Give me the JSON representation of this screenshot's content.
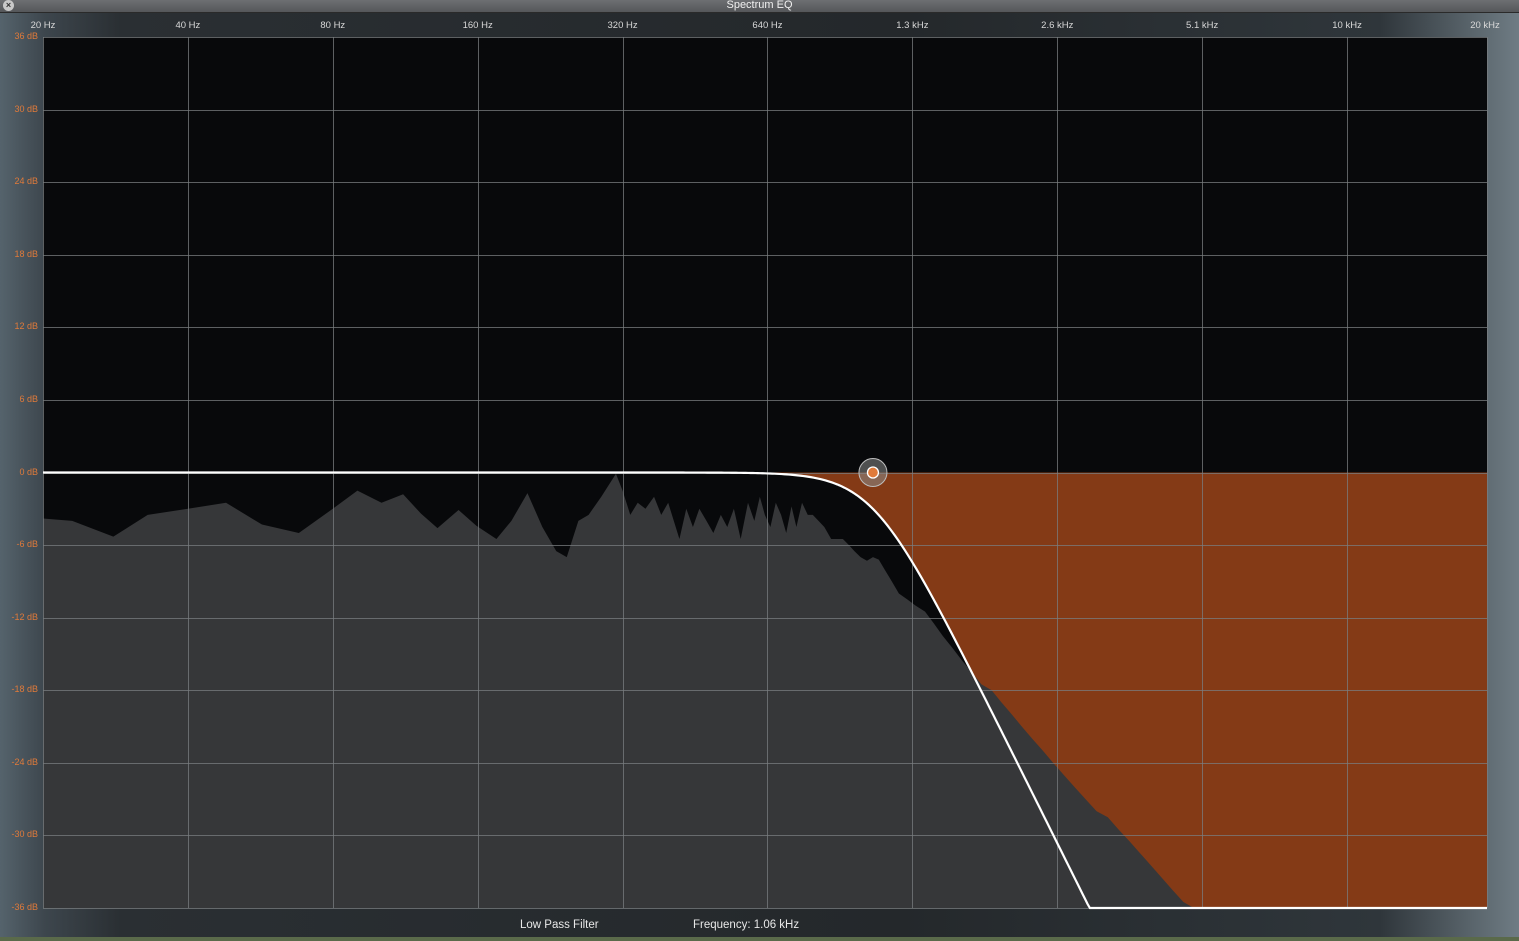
{
  "window": {
    "title": "Spectrum EQ",
    "close_label": "×"
  },
  "axes": {
    "x_labels": [
      "20 Hz",
      "40 Hz",
      "80 Hz",
      "160 Hz",
      "320 Hz",
      "640 Hz",
      "1.3 kHz",
      "2.6 kHz",
      "5.1 kHz",
      "10 kHz",
      "20 kHz"
    ],
    "y_labels": [
      "36 dB",
      "30 dB",
      "24 dB",
      "18 dB",
      "12 dB",
      "6 dB",
      "0 dB",
      "-6 dB",
      "-12 dB",
      "-18 dB",
      "-24 dB",
      "-30 dB",
      "-36 dB"
    ]
  },
  "footer": {
    "filter_type": "Low Pass Filter",
    "frequency_readout": "Frequency: 1.06 kHz"
  },
  "colors": {
    "accent": "#e07a3a",
    "cut_region": "#843a16",
    "spectrum_fill": "#363739",
    "curve": "#ffffff",
    "plot_background": "#08090b",
    "grid": "#7a7d80"
  },
  "chart_data": {
    "type": "area",
    "x_scale": "log",
    "xlim": [
      20,
      20000
    ],
    "ylim": [
      -36,
      36
    ],
    "grid": true,
    "filter": {
      "type": "low-pass",
      "cutoff_hz": 1060,
      "gain_db": 0,
      "slope_db_per_octave": 24
    },
    "spectrum": {
      "x": [
        20,
        23,
        28,
        33,
        40,
        48,
        57,
        68,
        80,
        90,
        101,
        112,
        122,
        132,
        146,
        159,
        175,
        188,
        203,
        218,
        233,
        245,
        259,
        272,
        289,
        310,
        320,
        332,
        344,
        357,
        372,
        385,
        398,
        420,
        434,
        448,
        462,
        478,
        494,
        512,
        528,
        545,
        563,
        583,
        601,
        617,
        632,
        649,
        666,
        683,
        700,
        718,
        735,
        755,
        776,
        795,
        817,
        840,
        868,
        895,
        918,
        945,
        970,
        999,
        1030,
        1060,
        1090,
        1120,
        1160,
        1200,
        1250,
        1300,
        1360,
        1420,
        1480,
        1550,
        1620,
        1700,
        1780,
        1870,
        1960,
        2060,
        2160,
        2270,
        2390,
        2510,
        2640,
        2780,
        2930,
        3090,
        3260,
        3430,
        3620,
        3810,
        4010,
        4220,
        4440,
        4680,
        4920,
        5180,
        5450,
        5730,
        6030,
        6340,
        6670,
        7010,
        7380,
        7760,
        8160,
        8580,
        9030,
        9500,
        10000,
        10500,
        11050,
        11620,
        12220,
        12850,
        13500
      ],
      "y": [
        -3.8,
        -4.0,
        -5.3,
        -3.5,
        -3.0,
        -2.5,
        -4.3,
        -5.0,
        -3.0,
        -1.5,
        -2.5,
        -1.8,
        -3.4,
        -4.6,
        -3.1,
        -4.4,
        -5.5,
        -4.0,
        -1.7,
        -4.5,
        -6.5,
        -7.0,
        -4.0,
        -3.5,
        -2.0,
        -0.1,
        -1.5,
        -3.5,
        -2.5,
        -3.0,
        -2.0,
        -3.5,
        -2.5,
        -5.5,
        -3.0,
        -4.5,
        -3.0,
        -4.0,
        -5.0,
        -3.5,
        -4.5,
        -3.0,
        -5.5,
        -2.5,
        -4.0,
        -2.0,
        -3.5,
        -4.5,
        -2.5,
        -3.5,
        -5.0,
        -2.8,
        -4.5,
        -2.5,
        -3.5,
        -3.5,
        -4.0,
        -4.5,
        -5.5,
        -5.5,
        -5.5,
        -6.0,
        -6.5,
        -7.0,
        -7.3,
        -7.0,
        -7.2,
        -8.0,
        -9.0,
        -10.0,
        -10.5,
        -11.0,
        -11.5,
        -12.5,
        -13.5,
        -14.5,
        -15.5,
        -16.5,
        -17.5,
        -18.0,
        -19.0,
        -20.0,
        -21.0,
        -22.0,
        -23.0,
        -24.0,
        -25.0,
        -26.0,
        -27.0,
        -28.0,
        -28.5,
        -29.5,
        -30.5,
        -31.5,
        -32.5,
        -33.5,
        -34.5,
        -35.5,
        -36,
        -36,
        -36,
        -36,
        -36,
        -36,
        -36,
        -36,
        -36,
        -36,
        -36,
        -36,
        -36,
        -36,
        -36,
        -36,
        -36,
        -36,
        -36,
        -36,
        -36
      ]
    }
  }
}
